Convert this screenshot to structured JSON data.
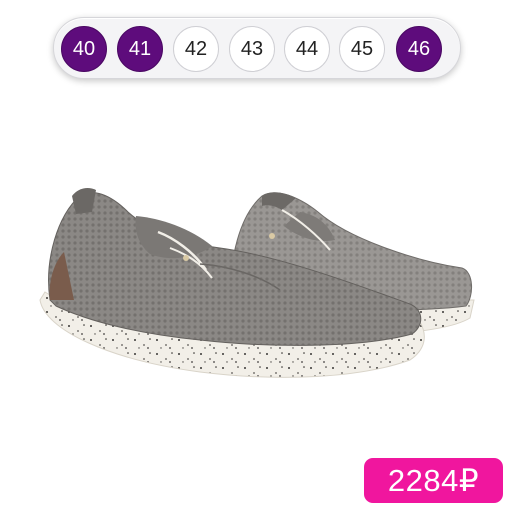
{
  "sizes": [
    {
      "label": "40",
      "available": false
    },
    {
      "label": "41",
      "available": false
    },
    {
      "label": "42",
      "available": true
    },
    {
      "label": "43",
      "available": true
    },
    {
      "label": "44",
      "available": true
    },
    {
      "label": "45",
      "available": true
    },
    {
      "label": "46",
      "available": false
    }
  ],
  "colors": {
    "unavailable_chip": "#5e0c7c",
    "available_chip": "#ffffff",
    "price_badge": "#f0169e",
    "shoe_upper": "#8a8784",
    "shoe_sole": "#f1eee6",
    "heel_patch": "#7a5c4c"
  },
  "product": {
    "image": "grey knit slip-on lace-up shoes with speckled white sole"
  },
  "price": {
    "label": "2284₽"
  }
}
